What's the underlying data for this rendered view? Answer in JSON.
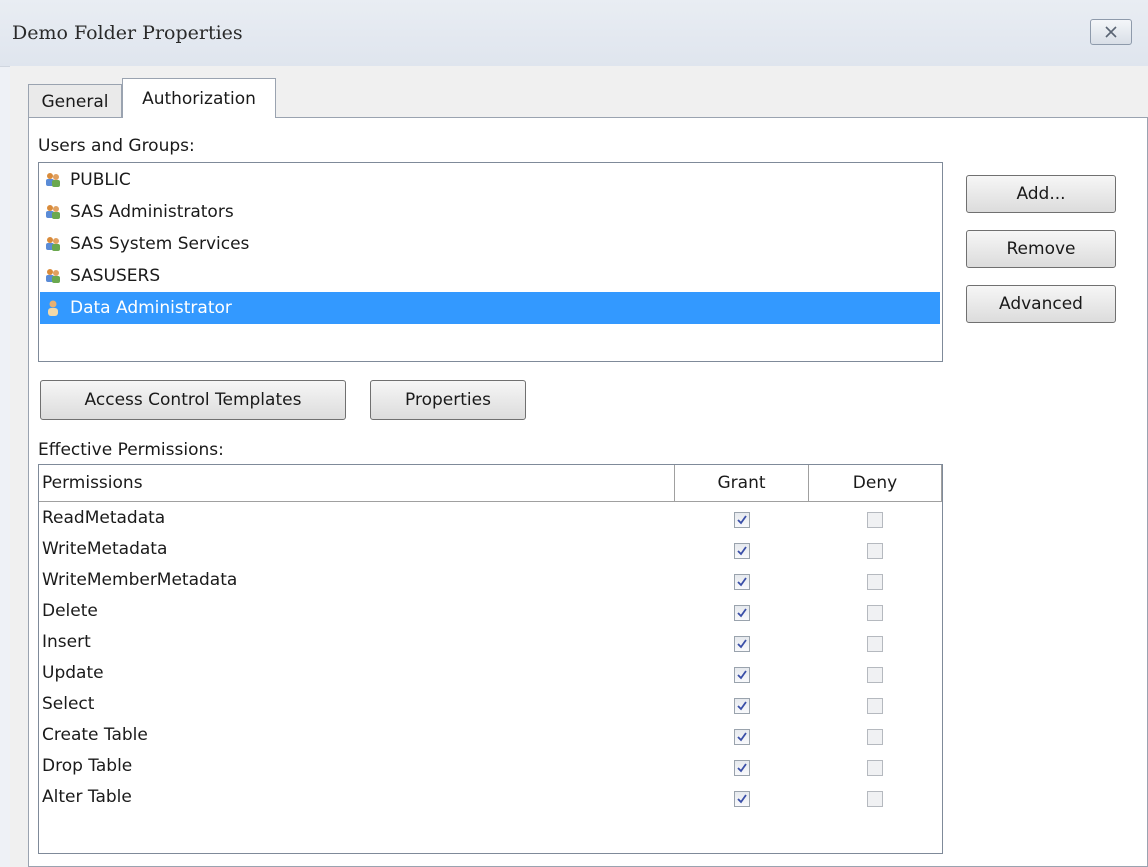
{
  "window": {
    "title": "Demo Folder Properties"
  },
  "tabs": [
    {
      "label": "General",
      "active": false
    },
    {
      "label": "Authorization",
      "active": true
    }
  ],
  "users_groups": {
    "label": "Users and Groups:",
    "items": [
      {
        "label": "PUBLIC",
        "icon": "group-icon",
        "selected": false
      },
      {
        "label": "SAS Administrators",
        "icon": "group-icon",
        "selected": false
      },
      {
        "label": "SAS System Services",
        "icon": "group-icon",
        "selected": false
      },
      {
        "label": "SASUSERS",
        "icon": "group-icon",
        "selected": false
      },
      {
        "label": "Data Administrator",
        "icon": "user-icon",
        "selected": true
      }
    ]
  },
  "side_buttons": {
    "add": "Add...",
    "remove": "Remove",
    "advanced": "Advanced"
  },
  "action_buttons": {
    "templates": "Access Control Templates",
    "properties": "Properties"
  },
  "permissions": {
    "label": "Effective Permissions:",
    "columns": [
      "Permissions",
      "Grant",
      "Deny"
    ],
    "rows": [
      {
        "name": "ReadMetadata",
        "grant": true,
        "deny": false
      },
      {
        "name": "WriteMetadata",
        "grant": true,
        "deny": false
      },
      {
        "name": "WriteMemberMetadata",
        "grant": true,
        "deny": false
      },
      {
        "name": "Delete",
        "grant": true,
        "deny": false
      },
      {
        "name": "Insert",
        "grant": true,
        "deny": false
      },
      {
        "name": "Update",
        "grant": true,
        "deny": false
      },
      {
        "name": "Select",
        "grant": true,
        "deny": false
      },
      {
        "name": "Create Table",
        "grant": true,
        "deny": false
      },
      {
        "name": "Drop Table",
        "grant": true,
        "deny": false
      },
      {
        "name": "Alter Table",
        "grant": true,
        "deny": false
      }
    ]
  },
  "colors": {
    "selection": "#3399ff",
    "check": "#3a4fa8"
  }
}
